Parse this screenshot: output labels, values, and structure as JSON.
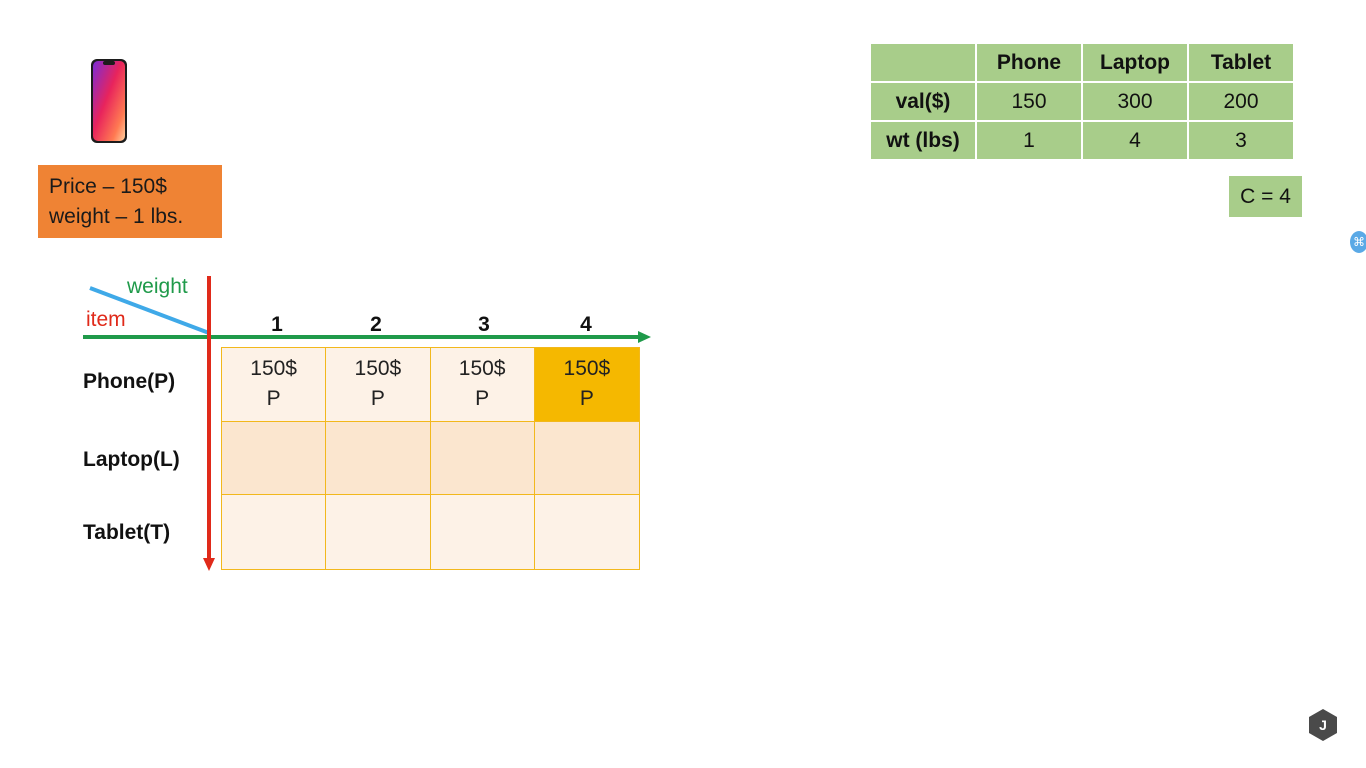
{
  "price_box": {
    "line1": "Price – 150$",
    "line2": "weight – 1 lbs."
  },
  "axis": {
    "weight_label": "weight",
    "item_label": "item"
  },
  "columns": [
    "1",
    "2",
    "3",
    "4"
  ],
  "rows": [
    {
      "label": "Phone(P)",
      "cells": [
        [
          "150$",
          "P"
        ],
        [
          "150$",
          "P"
        ],
        [
          "150$",
          "P"
        ],
        [
          "150$",
          "P"
        ]
      ]
    },
    {
      "label": "Laptop(L)",
      "cells": [
        [
          "",
          ""
        ],
        [
          "",
          ""
        ],
        [
          "",
          ""
        ],
        [
          "",
          ""
        ]
      ]
    },
    {
      "label": "Tablet(T)",
      "cells": [
        [
          "",
          ""
        ],
        [
          "",
          ""
        ],
        [
          "",
          ""
        ],
        [
          "",
          ""
        ]
      ]
    }
  ],
  "highlighted_cell": {
    "row": 0,
    "col": 3
  },
  "values_table": {
    "headers": [
      "Phone",
      "Laptop",
      "Tablet"
    ],
    "rows": [
      {
        "label": "val($)",
        "values": [
          "150",
          "300",
          "200"
        ]
      },
      {
        "label": "wt (lbs)",
        "values": [
          "1",
          "4",
          "3"
        ]
      }
    ]
  },
  "capacity": "C = 4",
  "badge": "J",
  "colors": {
    "price_box": "#ef8334",
    "weight_axis": "#1f9a4a",
    "item_axis": "#e02a1a",
    "diag_line": "#3fa9e8",
    "table_green": "#a8cd8a",
    "highlight": "#f5b800"
  }
}
